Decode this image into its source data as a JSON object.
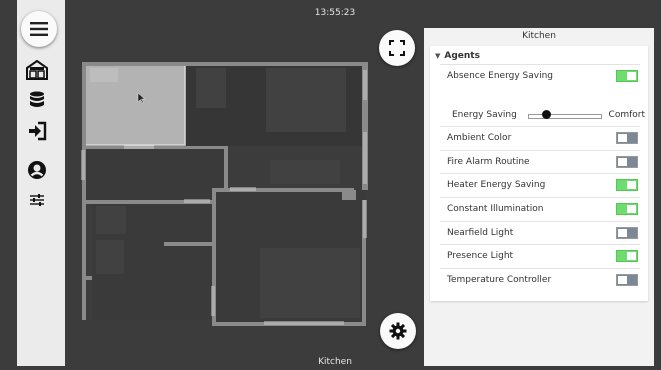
{
  "clock": "13:55:23",
  "footer_room": "Kitchen",
  "sidebar": {
    "items": [
      {
        "icon": "home-icon"
      },
      {
        "icon": "database-icon"
      },
      {
        "icon": "login-icon"
      },
      {
        "icon": "user-icon"
      },
      {
        "icon": "sliders-icon"
      }
    ]
  },
  "buttons": {
    "fullscreen_icon": "fullscreen-icon",
    "settings_icon": "gear-icon"
  },
  "panel": {
    "title": "Kitchen",
    "section": "Agents",
    "slider": {
      "left_label": "Energy Saving",
      "right_label": "Comfort",
      "value": 0.25
    },
    "agents": [
      {
        "label": "Absence Energy Saving",
        "on": true
      },
      {
        "label": "Ambient Color",
        "on": false
      },
      {
        "label": "Fire Alarm Routine",
        "on": false
      },
      {
        "label": "Heater Energy Saving",
        "on": true
      },
      {
        "label": "Constant Illumination",
        "on": true
      },
      {
        "label": "Nearfield Light",
        "on": false
      },
      {
        "label": "Presence Light",
        "on": true
      },
      {
        "label": "Temperature Controller",
        "on": false
      }
    ]
  },
  "colors": {
    "toggle_on": "#6fdc6f",
    "toggle_off": "#7d8897",
    "selected_room": "#b3b3b3"
  }
}
